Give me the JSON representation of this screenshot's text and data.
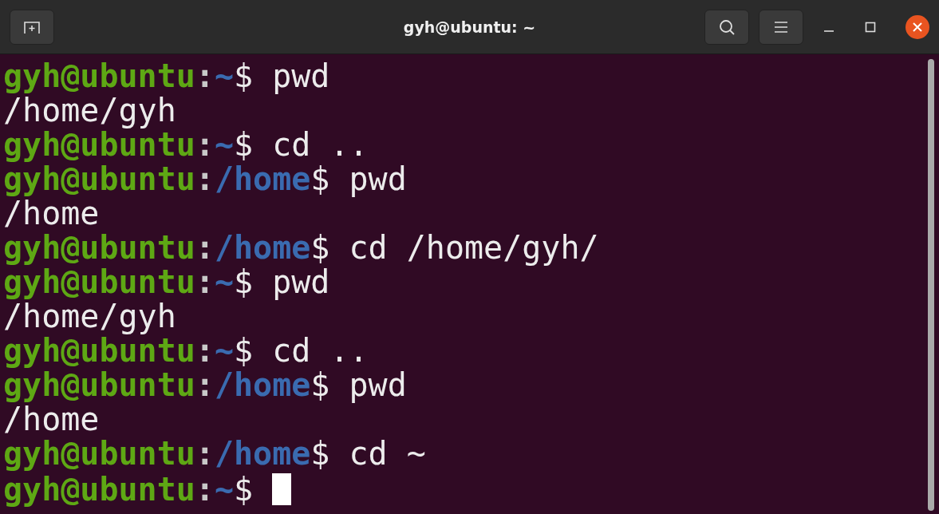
{
  "window": {
    "title": "gyh@ubuntu: ~"
  },
  "terminal": {
    "lines": [
      {
        "kind": "prompt",
        "user": "gyh@ubuntu",
        "separator": ":",
        "path": "~",
        "symbol": "$",
        "command": " pwd",
        "cursor": false
      },
      {
        "kind": "output",
        "text": "/home/gyh"
      },
      {
        "kind": "prompt",
        "user": "gyh@ubuntu",
        "separator": ":",
        "path": "~",
        "symbol": "$",
        "command": " cd ..",
        "cursor": false
      },
      {
        "kind": "prompt",
        "user": "gyh@ubuntu",
        "separator": ":",
        "path": "/home",
        "symbol": "$",
        "command": " pwd",
        "cursor": false
      },
      {
        "kind": "output",
        "text": "/home"
      },
      {
        "kind": "prompt",
        "user": "gyh@ubuntu",
        "separator": ":",
        "path": "/home",
        "symbol": "$",
        "command": " cd /home/gyh/",
        "cursor": false
      },
      {
        "kind": "prompt",
        "user": "gyh@ubuntu",
        "separator": ":",
        "path": "~",
        "symbol": "$",
        "command": " pwd",
        "cursor": false
      },
      {
        "kind": "output",
        "text": "/home/gyh"
      },
      {
        "kind": "prompt",
        "user": "gyh@ubuntu",
        "separator": ":",
        "path": "~",
        "symbol": "$",
        "command": " cd ..",
        "cursor": false
      },
      {
        "kind": "prompt",
        "user": "gyh@ubuntu",
        "separator": ":",
        "path": "/home",
        "symbol": "$",
        "command": " pwd",
        "cursor": false
      },
      {
        "kind": "output",
        "text": "/home"
      },
      {
        "kind": "prompt",
        "user": "gyh@ubuntu",
        "separator": ":",
        "path": "/home",
        "symbol": "$",
        "command": " cd ~",
        "cursor": false
      },
      {
        "kind": "prompt",
        "user": "gyh@ubuntu",
        "separator": ":",
        "path": "~",
        "symbol": "$",
        "cursor": true
      }
    ]
  }
}
